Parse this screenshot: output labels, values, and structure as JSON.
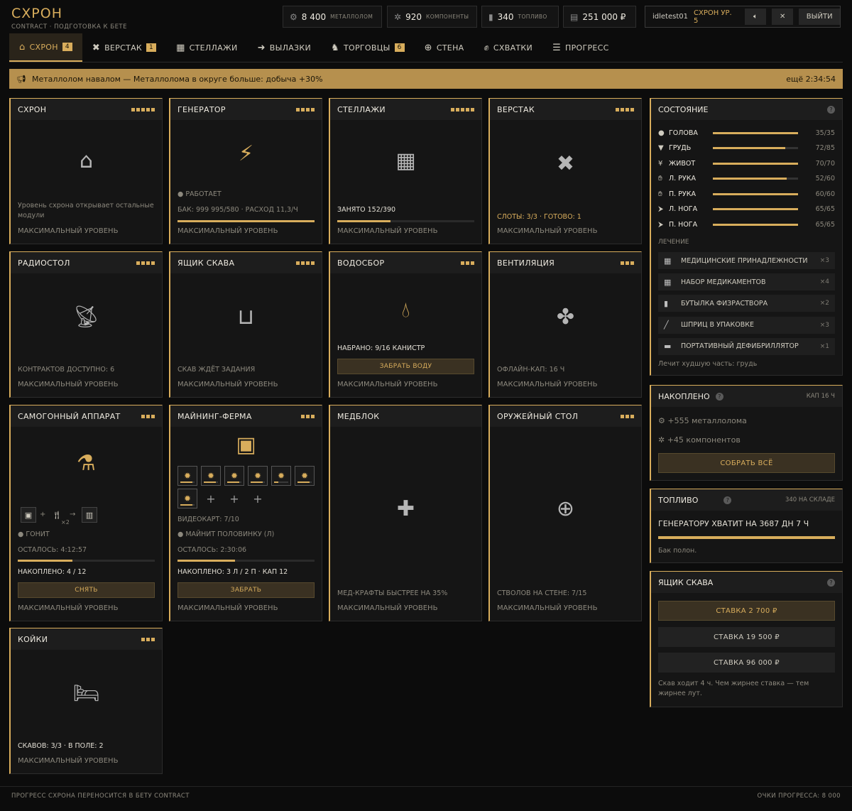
{
  "header": {
    "title": "СХРОН",
    "subtitle": "CONTRACT · ПОДГОТОВКА К БЕТЕ"
  },
  "resources": [
    {
      "value": "8 400",
      "label": "МЕТАЛЛОЛОМ",
      "icon": "scrap-icon"
    },
    {
      "value": "920",
      "label": "КОМПОНЕНТЫ",
      "icon": "components-icon"
    },
    {
      "value": "340",
      "label": "ТОПЛИВО",
      "icon": "fuel-icon"
    },
    {
      "value": "251 000 ₽",
      "label": "",
      "icon": "money-icon"
    }
  ],
  "user": {
    "name": "idletest01",
    "level": "СХРОН УР. 5",
    "logout": "ВЫЙТИ"
  },
  "nav": [
    {
      "label": "СХРОН",
      "badge": "4",
      "icon": "bunker-icon",
      "active": true
    },
    {
      "label": "ВЕРСТАК",
      "badge": "1",
      "icon": "tools-icon"
    },
    {
      "label": "СТЕЛЛАЖИ",
      "badge": "",
      "icon": "boxes-icon"
    },
    {
      "label": "ВЫЛАЗКИ",
      "badge": "",
      "icon": "runner-icon"
    },
    {
      "label": "ТОРГОВЦЫ",
      "badge": "6",
      "icon": "trader-icon"
    },
    {
      "label": "СТЕНА",
      "badge": "",
      "icon": "crosshair-icon"
    },
    {
      "label": "СХВАТКИ",
      "badge": "",
      "icon": "fist-icon"
    },
    {
      "label": "ПРОГРЕСС",
      "badge": "",
      "icon": "list-icon"
    }
  ],
  "banner": {
    "text": "Металлолом навалом — Металлолома в округе больше: добыча +30%",
    "timer": "ещё 2:34:54"
  },
  "modules": {
    "shelter": {
      "name": "СХРОН",
      "dots": 5,
      "text": "Уровень схрона открывает остальные модули",
      "max": "МАКСИМАЛЬНЫЙ УРОВЕНЬ"
    },
    "generator": {
      "name": "ГЕНЕРАТОР",
      "dots": 4,
      "status": "РАБОТАЕТ",
      "info": "БАК: 999 995/580 · РАСХОД 11,3/Ч",
      "progress": 1.0,
      "max": "МАКСИМАЛЬНЫЙ УРОВЕНЬ"
    },
    "racks": {
      "name": "СТЕЛЛАЖИ",
      "dots": 5,
      "info": "ЗАНЯТО 152/390",
      "progress": 0.39,
      "max": "МАКСИМАЛЬНЫЙ УРОВЕНЬ"
    },
    "workbench": {
      "name": "ВЕРСТАК",
      "dots": 4,
      "info": "СЛОТЫ: 3/3 · ГОТОВО: 1",
      "max": "МАКСИМАЛЬНЫЙ УРОВЕНЬ"
    },
    "radio": {
      "name": "РАДИОСТОЛ",
      "dots": 4,
      "info": "КОНТРАКТОВ ДОСТУПНО: 6",
      "max": "МАКСИМАЛЬНЫЙ УРОВЕНЬ"
    },
    "scavbox": {
      "name": "ЯЩИК СКАВА",
      "dots": 4,
      "info": "СКАВ ЖДЁТ ЗАДАНИЯ",
      "max": "МАКСИМАЛЬНЫЙ УРОВЕНЬ"
    },
    "water": {
      "name": "ВОДОСБОР",
      "dots": 3,
      "info": "НАБРАНО: 9/16 КАНИСТР",
      "button": "ЗАБРАТЬ ВОДУ",
      "max": "МАКСИМАЛЬНЫЙ УРОВЕНЬ"
    },
    "vent": {
      "name": "ВЕНТИЛЯЦИЯ",
      "dots": 3,
      "info": "ОФЛАЙН-КАП: 16 Ч",
      "max": "МАКСИМАЛЬНЫЙ УРОВЕНЬ"
    },
    "still": {
      "name": "САМОГОННЫЙ АППАРАТ",
      "dots": 3,
      "ing_mult": "×2",
      "status": "ГОНИТ",
      "left": "ОСТАЛОСЬ: 4:12:57",
      "progress": 0.4,
      "stock": "НАКОПЛЕНО: 4 / 12",
      "button": "СНЯТЬ",
      "max": "МАКСИМАЛЬНЫЙ УРОВЕНЬ"
    },
    "mining": {
      "name": "МАЙНИНГ-ФЕРМА",
      "dots": 3,
      "slots": [
        0.85,
        0.85,
        0.85,
        0.85,
        0.3,
        0.85,
        0.85
      ],
      "empty_slots": 3,
      "cards": "ВИДЕОКАРТ: 7/10",
      "status": "МАЙНИТ ПОЛОВИНКУ (Л)",
      "left": "ОСТАЛОСЬ: 2:30:06",
      "progress": 0.42,
      "stock": "НАКОПЛЕНО: 3 Л / 2 П · КАП 12",
      "button": "ЗАБРАТЬ",
      "max": "МАКСИМАЛЬНЫЙ УРОВЕНЬ"
    },
    "medblock": {
      "name": "МЕДБЛОК",
      "dots": 0,
      "info": "МЕД-КРАФТЫ БЫСТРЕЕ НА 35%",
      "max": "МАКСИМАЛЬНЫЙ УРОВЕНЬ"
    },
    "armory": {
      "name": "ОРУЖЕЙНЫЙ СТОЛ",
      "dots": 3,
      "info": "СТВОЛОВ НА СТЕНЕ: 7/15",
      "max": "МАКСИМАЛЬНЫЙ УРОВЕНЬ"
    },
    "beds": {
      "name": "КОЙКИ",
      "dots": 3,
      "info": "СКАВОВ: 3/3 · В ПОЛЕ: 2",
      "max": "МАКСИМАЛЬНЫЙ УРОВЕНЬ"
    }
  },
  "status": {
    "title": "СОСТОЯНИЕ",
    "body": [
      {
        "name": "ГОЛОВА",
        "value": "35/35",
        "fill": 1.0,
        "icon": "head-icon"
      },
      {
        "name": "ГРУДЬ",
        "value": "72/85",
        "fill": 0.85,
        "icon": "chest-icon"
      },
      {
        "name": "ЖИВОТ",
        "value": "70/70",
        "fill": 1.0,
        "icon": "stomach-icon"
      },
      {
        "name": "Л. РУКА",
        "value": "52/60",
        "fill": 0.87,
        "icon": "hand-icon"
      },
      {
        "name": "П. РУКА",
        "value": "60/60",
        "fill": 1.0,
        "icon": "hand-icon"
      },
      {
        "name": "Л. НОГА",
        "value": "65/65",
        "fill": 1.0,
        "icon": "leg-icon"
      },
      {
        "name": "П. НОГА",
        "value": "65/65",
        "fill": 1.0,
        "icon": "leg-icon"
      }
    ],
    "heal_label": "ЛЕЧЕНИЕ",
    "meds": [
      {
        "name": "МЕДИЦИНСКИЕ ПРИНАДЛЕЖНОСТИ",
        "qty": "×3"
      },
      {
        "name": "НАБОР МЕДИКАМЕНТОВ",
        "qty": "×4"
      },
      {
        "name": "БУТЫЛКА ФИЗРАСТВОРА",
        "qty": "×2"
      },
      {
        "name": "ШПРИЦ В УПАКОВКЕ",
        "qty": "×3"
      },
      {
        "name": "ПОРТАТИВНЫЙ ДЕФИБРИЛЛЯТОР",
        "qty": "×1"
      }
    ],
    "note": "Лечит худшую часть: грудь"
  },
  "accum": {
    "title": "НАКОПЛЕНО",
    "cap": "КАП 16 Ч",
    "scrap": "+555 металлолома",
    "comp": "+45 компонентов",
    "button": "СОБРАТЬ ВСЁ"
  },
  "fuel": {
    "title": "ТОПЛИВО",
    "stock": "340 НА СКЛАДЕ",
    "line": "ГЕНЕРАТОРУ ХВАТИТ НА 3687 ДН 7 Ч",
    "fill": 1.0,
    "note": "Бак полон."
  },
  "scav": {
    "title": "ЯЩИК СКАВА",
    "bets": [
      "СТАВКА 2 700 ₽",
      "СТАВКА 19 500 ₽",
      "СТАВКА 96 000 ₽"
    ],
    "note": "Скав ходит 4 ч. Чем жирнее ставка — тем жирнее лут."
  },
  "footer": {
    "left": "ПРОГРЕСС СХРОНА ПЕРЕНОСИТСЯ В БЕТУ CONTRACT",
    "right": "ОЧКИ ПРОГРЕССА: 8 000"
  },
  "colors": {
    "accent": "#d8ad5c",
    "bg": "#0c0c0c",
    "card": "#151515"
  }
}
